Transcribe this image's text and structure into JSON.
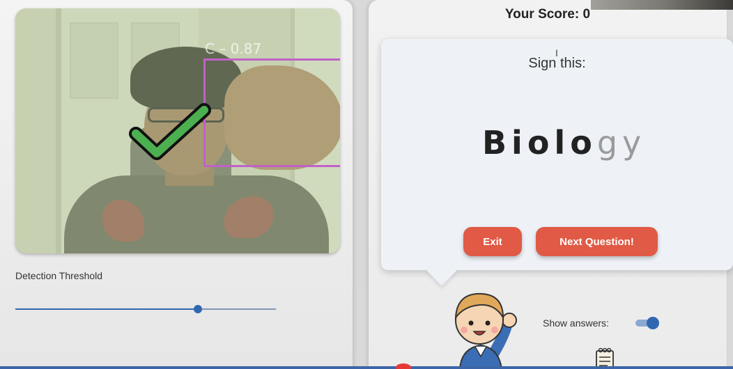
{
  "header": {
    "score_label": "Your Score: 0"
  },
  "camera": {
    "detection_label": "C – 0.87",
    "detection_confidence": 0.87,
    "detected_letter": "C",
    "overlay_icon": "checkmark-icon"
  },
  "threshold": {
    "label": "Detection Threshold",
    "value_fraction": 0.7
  },
  "prompt": {
    "instruction": "Sign this:",
    "word_completed": "Biolo",
    "word_remaining": "gy"
  },
  "buttons": {
    "exit_label": "Exit",
    "next_label": "Next Question!"
  },
  "answers": {
    "label": "Show answers:",
    "enabled": true
  },
  "icons": {
    "mascot": "waving-boy-icon",
    "notepad": "notepad-icon"
  },
  "colors": {
    "accent_button": "#e05a45",
    "slider_blue": "#2f67b1",
    "bbox_magenta": "#c061c8",
    "check_green": "#4caf50"
  }
}
